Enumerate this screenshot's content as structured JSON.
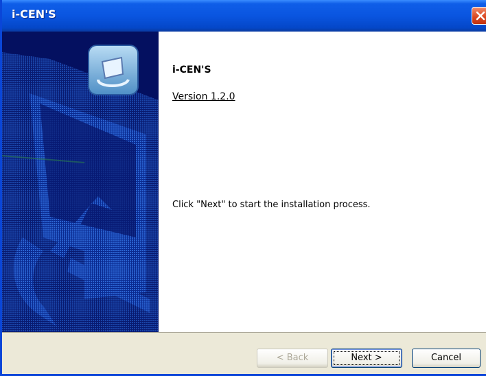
{
  "window": {
    "title": "i-CEN'S",
    "close_icon": "close-icon"
  },
  "banner": {
    "app_icon": "installer-app-icon",
    "artwork": "circular-arrow-banner-art"
  },
  "content": {
    "app_name": "i-CEN'S",
    "version": "Version 1.2.0",
    "instructions": "Click \"Next\" to start the installation process."
  },
  "buttons": {
    "back": {
      "prefix": "< ",
      "label": "Back",
      "enabled": false
    },
    "next": {
      "label": "Next",
      "suffix": " >",
      "enabled": true
    },
    "cancel": {
      "label": "Cancel",
      "enabled": true
    }
  },
  "colors": {
    "titlebar": "#0a55e0",
    "banner_bg": "#041060",
    "banner_art": "#1a4ab0",
    "close": "#d9461f",
    "dialog_bg": "#ece9d8"
  }
}
